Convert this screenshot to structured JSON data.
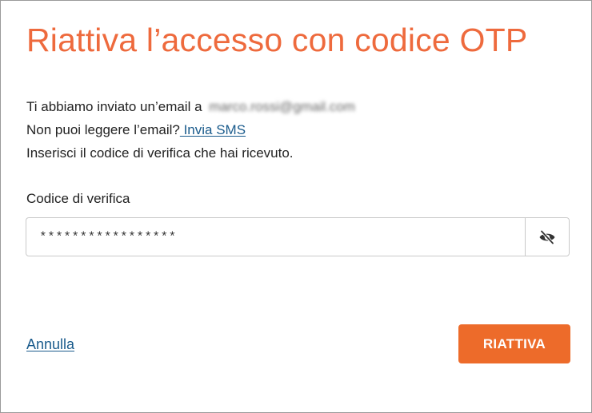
{
  "dialog": {
    "title": "Riattiva l’accesso con codice OTP",
    "info": {
      "email_prefix": "Ti abbiamo inviato un’email a",
      "email_address": "marco.rossi@gmail.com",
      "sms_prompt": "Non puoi leggere l’email?",
      "sms_link": " Invia SMS",
      "instruction": "Inserisci il codice di verifica che hai ricevuto."
    },
    "field": {
      "label": "Codice di verifica",
      "value": "*****************",
      "toggle_icon": "eye-slash-icon"
    },
    "actions": {
      "cancel_label": "Annulla",
      "submit_label": "RIATTIVA"
    }
  },
  "colors": {
    "title": "#ee6a3d",
    "link": "#1a5b8c",
    "primary_button": "#ed6b2a",
    "border": "#c9c9c9"
  }
}
